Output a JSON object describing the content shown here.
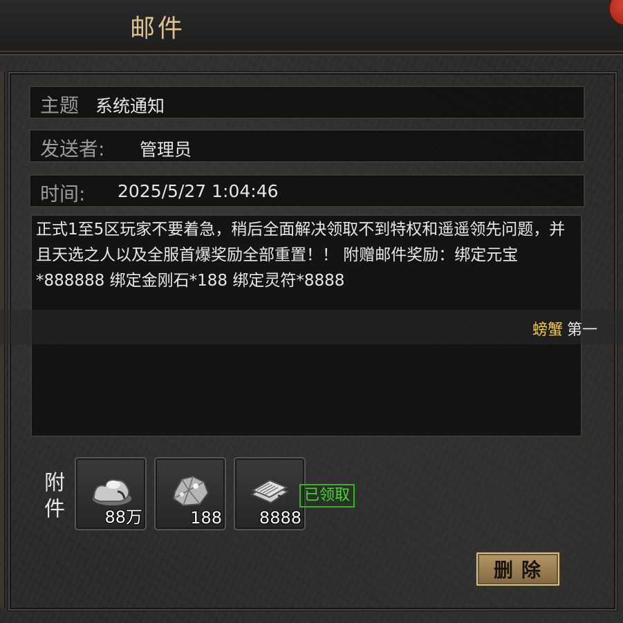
{
  "window": {
    "title": "邮件"
  },
  "mail": {
    "subject_label": "主题",
    "subject_value": "系统通知",
    "sender_label": "发送者:",
    "sender_value": "管理员",
    "time_label": "时间:",
    "time_value": "2025/5/27 1:04:46",
    "body": "正式1至5区玩家不要着急，稍后全面解决领取不到特权和遥遥领先问题，并且天选之人以及全服首爆奖励全部重置！！ 附赠邮件奖励：绑定元宝*888888 绑定金刚石*188 绑定灵符*8888"
  },
  "ticker": {
    "name": "螃蟹",
    "text": "第一"
  },
  "attachments": {
    "label": "附件",
    "items": [
      {
        "icon": "ingot-icon",
        "count": "88万"
      },
      {
        "icon": "diamond-ore-icon",
        "count": "188"
      },
      {
        "icon": "talisman-bundle-icon",
        "count": "8888"
      }
    ],
    "status": "已领取"
  },
  "actions": {
    "delete_label": "删除"
  },
  "colors": {
    "title": "#d9c291",
    "ticker_name": "#f2c84b",
    "claimed": "#4fd23a",
    "button": "#b69a6a"
  }
}
